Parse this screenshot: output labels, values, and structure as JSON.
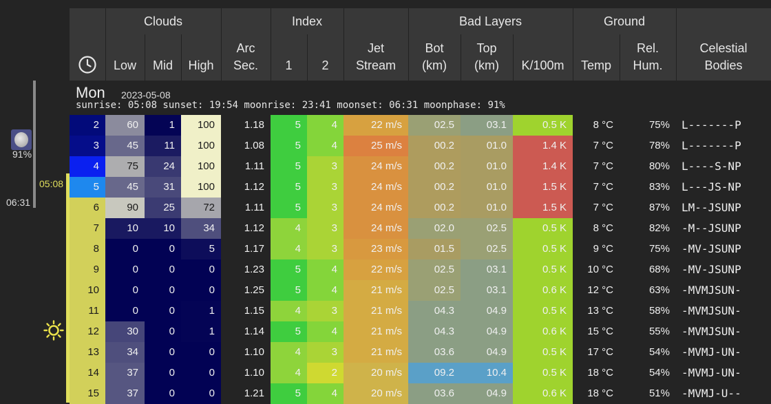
{
  "header": {
    "groups": [
      {
        "key": "clouds",
        "label": "Clouds"
      },
      {
        "key": "index",
        "label": "Index"
      },
      {
        "key": "bad_layers",
        "label": "Bad Layers"
      },
      {
        "key": "ground",
        "label": "Ground"
      }
    ],
    "columns": {
      "time_icon": "clock-icon",
      "low": "Low",
      "mid": "Mid",
      "high": "High",
      "arc": "Arc\nSec.",
      "idx1": "1",
      "idx2": "2",
      "jet": "Jet\nStream",
      "bot": "Bot\n(km)",
      "top": "Top\n(km)",
      "k100": "K/100m",
      "temp": "Temp",
      "hum": "Rel.\nHum.",
      "celestial": "Celestial\nBodies"
    }
  },
  "day": {
    "name": "Mon",
    "date": "2023-05-08",
    "sun_line": "sunrise: 05:08 sunset: 19:54 moonrise: 23:41 moonset: 06:31 moonphase: 91%"
  },
  "side": {
    "moon_icon": "moon-icon",
    "moon_phase": "91%",
    "sunrise_time": "05:08",
    "moonset_time": "06:31",
    "sun_icon": "sun-icon"
  },
  "colors": {
    "sun_bar": "#e0df5c",
    "night": "#020254",
    "cloud_full": "#f0f0c8"
  },
  "rows": [
    {
      "hour": "2",
      "low": "60",
      "mid": "1",
      "high": "100",
      "arc": "1.18",
      "i1": "5",
      "i2": "4",
      "jet": "22 m/s",
      "bot": "02.5",
      "top": "03.1",
      "k": "0.5 K",
      "temp": "8 °C",
      "hum": "75%",
      "cel": "L-------P"
    },
    {
      "hour": "3",
      "low": "45",
      "mid": "11",
      "high": "100",
      "arc": "1.08",
      "i1": "5",
      "i2": "4",
      "jet": "25 m/s",
      "bot": "00.2",
      "top": "01.0",
      "k": "1.4 K",
      "temp": "7 °C",
      "hum": "78%",
      "cel": "L-------P"
    },
    {
      "hour": "4",
      "low": "75",
      "mid": "24",
      "high": "100",
      "arc": "1.11",
      "i1": "5",
      "i2": "3",
      "jet": "24 m/s",
      "bot": "00.2",
      "top": "01.0",
      "k": "1.4 K",
      "temp": "7 °C",
      "hum": "80%",
      "cel": "L----S-NP"
    },
    {
      "hour": "5",
      "low": "45",
      "mid": "31",
      "high": "100",
      "arc": "1.12",
      "i1": "5",
      "i2": "3",
      "jet": "24 m/s",
      "bot": "00.2",
      "top": "01.0",
      "k": "1.5 K",
      "temp": "7 °C",
      "hum": "83%",
      "cel": "L---JS-NP"
    },
    {
      "hour": "6",
      "low": "90",
      "mid": "25",
      "high": "72",
      "arc": "1.11",
      "i1": "5",
      "i2": "3",
      "jet": "24 m/s",
      "bot": "00.2",
      "top": "01.0",
      "k": "1.5 K",
      "temp": "7 °C",
      "hum": "87%",
      "cel": "LM--JSUNP"
    },
    {
      "hour": "7",
      "low": "10",
      "mid": "10",
      "high": "34",
      "arc": "1.12",
      "i1": "4",
      "i2": "3",
      "jet": "24 m/s",
      "bot": "02.0",
      "top": "02.5",
      "k": "0.5 K",
      "temp": "8 °C",
      "hum": "82%",
      "cel": "-M--JSUNP"
    },
    {
      "hour": "8",
      "low": "0",
      "mid": "0",
      "high": "5",
      "arc": "1.17",
      "i1": "4",
      "i2": "3",
      "jet": "23 m/s",
      "bot": "01.5",
      "top": "02.5",
      "k": "0.5 K",
      "temp": "9 °C",
      "hum": "75%",
      "cel": "-MV-JSUNP"
    },
    {
      "hour": "9",
      "low": "0",
      "mid": "0",
      "high": "0",
      "arc": "1.23",
      "i1": "5",
      "i2": "4",
      "jet": "22 m/s",
      "bot": "02.5",
      "top": "03.1",
      "k": "0.5 K",
      "temp": "10 °C",
      "hum": "68%",
      "cel": "-MV-JSUNP"
    },
    {
      "hour": "10",
      "low": "0",
      "mid": "0",
      "high": "0",
      "arc": "1.25",
      "i1": "5",
      "i2": "4",
      "jet": "21 m/s",
      "bot": "02.5",
      "top": "03.1",
      "k": "0.6 K",
      "temp": "12 °C",
      "hum": "63%",
      "cel": "-MVMJSUN-"
    },
    {
      "hour": "11",
      "low": "0",
      "mid": "0",
      "high": "1",
      "arc": "1.15",
      "i1": "4",
      "i2": "3",
      "jet": "21 m/s",
      "bot": "04.3",
      "top": "04.9",
      "k": "0.5 K",
      "temp": "13 °C",
      "hum": "58%",
      "cel": "-MVMJSUN-"
    },
    {
      "hour": "12",
      "low": "30",
      "mid": "0",
      "high": "1",
      "arc": "1.14",
      "i1": "5",
      "i2": "4",
      "jet": "21 m/s",
      "bot": "04.3",
      "top": "04.9",
      "k": "0.6 K",
      "temp": "15 °C",
      "hum": "55%",
      "cel": "-MVMJSUN-"
    },
    {
      "hour": "13",
      "low": "34",
      "mid": "0",
      "high": "0",
      "arc": "1.10",
      "i1": "4",
      "i2": "3",
      "jet": "21 m/s",
      "bot": "03.6",
      "top": "04.9",
      "k": "0.5 K",
      "temp": "17 °C",
      "hum": "54%",
      "cel": "-MVMJ-UN-"
    },
    {
      "hour": "14",
      "low": "37",
      "mid": "0",
      "high": "0",
      "arc": "1.10",
      "i1": "4",
      "i2": "2",
      "jet": "20 m/s",
      "bot": "09.2",
      "top": "10.4",
      "k": "0.5 K",
      "temp": "18 °C",
      "hum": "54%",
      "cel": "-MVMJ-UN-"
    },
    {
      "hour": "15",
      "low": "37",
      "mid": "0",
      "high": "0",
      "arc": "1.21",
      "i1": "5",
      "i2": "4",
      "jet": "20 m/s",
      "bot": "03.6",
      "top": "04.9",
      "k": "0.6 K",
      "temp": "18 °C",
      "hum": "51%",
      "cel": "-MVMJ-U--"
    }
  ]
}
